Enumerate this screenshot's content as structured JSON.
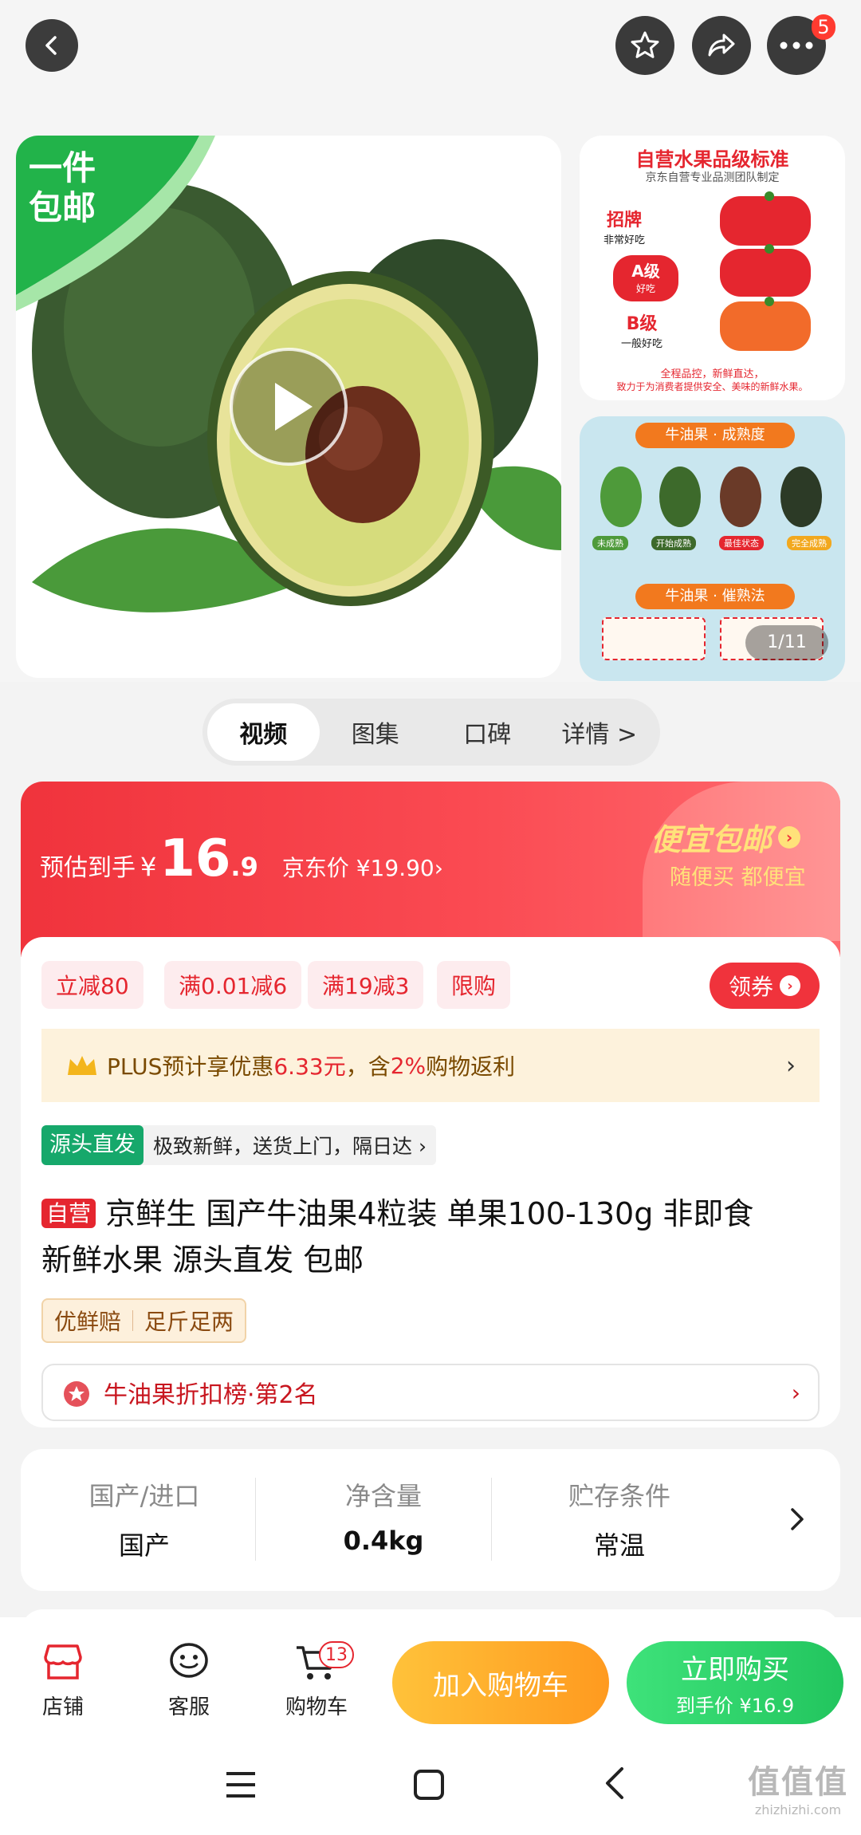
{
  "topbar": {
    "cart_badge": "5"
  },
  "gallery": {
    "promo_tag": "一件\n包邮",
    "grade_card": {
      "title": "自营水果品级标准",
      "subtitle": "京东自营专业品测团队制定",
      "grades": [
        {
          "name": "招牌",
          "desc": "非常好吃"
        },
        {
          "name": "A级",
          "desc": "好吃"
        },
        {
          "name": "B级",
          "desc": "一般好吃"
        }
      ],
      "footer1": "全程品控，新鲜直达，",
      "footer2": "致力于为消费者提供安全、美味的新鲜水果。"
    },
    "ripe_card": {
      "title1": "牛油果 · 成熟度",
      "stages": [
        "未成熟",
        "开始成熟",
        "最佳状态",
        "完全成熟"
      ],
      "title2": "牛油果 · 催熟法"
    },
    "counter": "1/11"
  },
  "tabs": [
    "视频",
    "图集",
    "口碑",
    "详情 >"
  ],
  "price": {
    "est_label": "预估到手",
    "currency": "¥",
    "int": "16",
    "dec": ".9",
    "jd_label": "京东价 ¥19.90›",
    "promo_title": "便宜包邮",
    "promo_sub": "随便买 都便宜"
  },
  "coupons": [
    "立减80",
    "满0.01减6",
    "满19减3",
    "限购"
  ],
  "coupon_btn": "领券",
  "plus": {
    "text": "PLUS预计享优惠",
    "amount": "6.33元",
    "text2": "，含",
    "pct": "2%",
    "text3": "购物返利"
  },
  "source": {
    "tag": "源头直发",
    "desc": "极致新鲜，送货上门，隔日达 ›"
  },
  "title": {
    "tag": "自营",
    "line1": "京鲜生 国产牛油果4粒装 单果100-130g 非即食",
    "line2": "新鲜水果 源头直发 包邮"
  },
  "service_tags": [
    "优鲜赔",
    "足斤足两"
  ],
  "rank": "牛油果折扣榜·第2名",
  "attrs": [
    {
      "label": "国产/进口",
      "value": "国产"
    },
    {
      "label": "净含量",
      "value": "0.4kg"
    },
    {
      "label": "贮存条件",
      "value": "常温"
    }
  ],
  "bottom": {
    "shop": "店铺",
    "service": "客服",
    "cart": "购物车",
    "cart_badge": "13",
    "add_cart": "加入购物车",
    "buy": "立即购买",
    "buy_sub": "到手价 ¥16.9"
  },
  "watermark": {
    "title": "值值值",
    "sub": "zhizhizhi.com"
  },
  "colors": {
    "primary_red": "#f0333c",
    "orange_btn": "#ffb72b",
    "green_btn": "#2ed36a",
    "gold_text": "#ffe27a"
  }
}
